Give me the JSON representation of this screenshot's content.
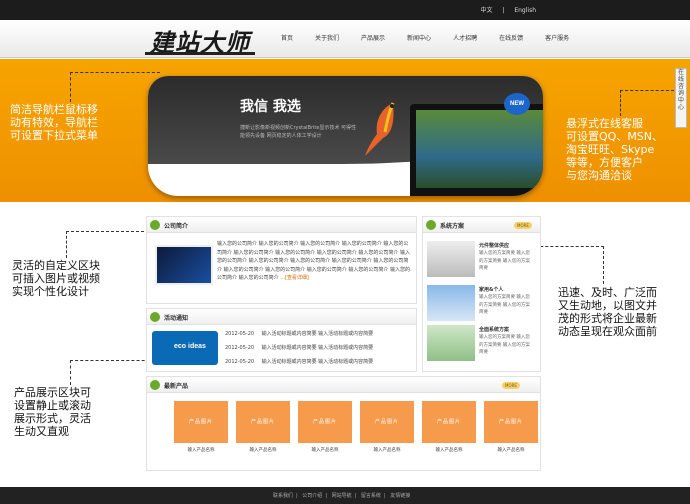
{
  "toplinks": {
    "zh": "中文",
    "sep": "|",
    "en": "English"
  },
  "logo": "建站大师",
  "nav": [
    "首页",
    "关于我们",
    "产品展示",
    "新闻中心",
    "人才招聘",
    "在线反馈",
    "客户服务"
  ],
  "hero": {
    "slogan": "我信 我选",
    "text": "捷新让影像新视频创新CrystalBrite显示技术 可得性能领先设备 网页稳定的人体工学设计",
    "badge": "NEW"
  },
  "float_button": "在线咨询中心",
  "notes": {
    "left_top": "简洁导航栏鼠标移\n动有特效，导航栏\n可设置下拉式菜单",
    "left_mid": "灵活的自定义区块\n可插入图片或视频\n实现个性化设计",
    "left_bottom": "产品展示区块可\n设置静止或滚动\n展示形式，灵活\n生动又直观",
    "right_top": "悬浮式在线客服\n可设置QQ、MSN、\n淘宝旺旺、Skype\n等等，方便客户\n与您沟通洽谈",
    "right_mid": "迅速、及时、广泛而\n又生动地，以图文并\n茂的形式将企业最新\n动态呈现在观众面前"
  },
  "intro": {
    "title": "公司简介",
    "text": "输入您的公司简介 输入您的公司简介 输入您的公司简介 输入您的公司简介 输入您的公司简介 输入您的公司简介 输入您的公司简介 输入您的公司简介 输入您的公司简介 输入您的公司简介 输入您的公司简介 输入您的公司简介 输入您的公司简介 输入您的公司简介 输入您的公司简介 输入您的公司简介 输入您的公司简介 输入您的公司简介 输入您的公司简介 输入您的公司简介",
    "more": "...[查看详细]"
  },
  "notice": {
    "title": "活动通知",
    "image_text": "eco ideas",
    "rows": [
      {
        "date": "2012-05-20",
        "text": "输入活动标题或内容简要 输入活动标题或内容简要"
      },
      {
        "date": "2012-05-20",
        "text": "输入活动标题或内容简要 输入活动标题或内容简要"
      },
      {
        "date": "2012-05-20",
        "text": "输入活动标题或内容简要 输入活动标题或内容简要"
      }
    ]
  },
  "solution": {
    "title": "系统方案",
    "more": "MORE",
    "items": [
      {
        "name": "元件整体供应",
        "desc": "输入您的方案简要 输入您的方案简要 输入您的方案简要"
      },
      {
        "name": "家用&个人",
        "desc": "输入您的方案简要 输入您的方案简要 输入您的方案简要"
      },
      {
        "name": "全面系统方案",
        "desc": "输入您的方案简要 输入您的方案简要 输入您的方案简要"
      }
    ]
  },
  "products": {
    "title": "最新产品",
    "more": "MORE",
    "items": [
      {
        "image": "产品图片",
        "name": "输入产品名称"
      },
      {
        "image": "产品图片",
        "name": "输入产品名称"
      },
      {
        "image": "产品图片",
        "name": "输入产品名称"
      },
      {
        "image": "产品图片",
        "name": "输入产品名称"
      },
      {
        "image": "产品图片",
        "name": "输入产品名称"
      },
      {
        "image": "产品图片",
        "name": "输入产品名称"
      }
    ]
  },
  "footer": [
    "联系我们",
    "公司介绍",
    "网站导航",
    "留言系统",
    "友情链接"
  ],
  "colors": {
    "orange": "#f59b00",
    "green": "#6aa92a",
    "dark": "#1c1c1c"
  }
}
